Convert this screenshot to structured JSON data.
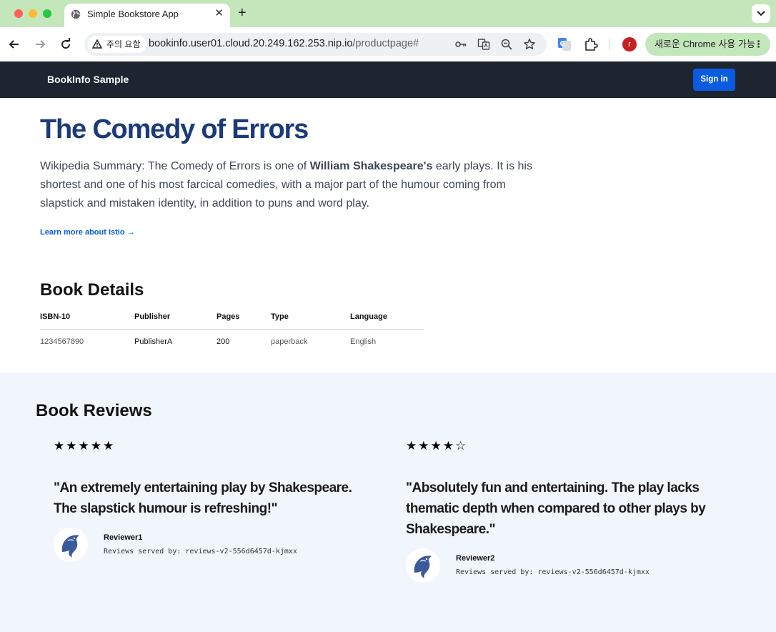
{
  "browser": {
    "tab_title": "Simple Bookstore App",
    "security_chip": "주의 요함",
    "url_host": "bookinfo.user01.cloud.20.249.162.253.nip.io",
    "url_path": "/productpage#",
    "profile_initial": "r",
    "update_label": "새로운 Chrome 사용 가능"
  },
  "navbar": {
    "brand": "BookInfo Sample",
    "signin_label": "Sign in"
  },
  "product": {
    "title": "The Comedy of Errors",
    "summary_prefix": "Wikipedia Summary: The Comedy of Errors is one of ",
    "summary_bold": "William Shakespeare's",
    "summary_suffix": " early plays. It is his shortest and one of his most farcical comedies, with a major part of the humour coming from slapstick and mistaken identity, in addition to puns and word play.",
    "learn_more": "Learn more about Istio →"
  },
  "details": {
    "heading": "Book Details",
    "columns": [
      "ISBN-10",
      "Publisher",
      "Pages",
      "Type",
      "Language"
    ],
    "values": [
      "1234567890",
      "PublisherA",
      "200",
      "paperback",
      "English"
    ]
  },
  "reviews": {
    "heading": "Book Reviews",
    "items": [
      {
        "rating": 5,
        "stars": "★★★★★",
        "text": "\"An extremely entertaining play by Shakespeare. The slapstick humour is refreshing!\"",
        "reviewer": "Reviewer1",
        "served_by": "Reviews served by: reviews-v2-556d6457d-kjmxx"
      },
      {
        "rating": 4,
        "stars": "★★★★☆",
        "text": "\"Absolutely fun and entertaining. The play lacks thematic depth when compared to other plays by Shakespeare.\"",
        "reviewer": "Reviewer2",
        "served_by": "Reviews served by: reviews-v2-556d6457d-kjmxx"
      }
    ]
  },
  "colors": {
    "navbar_bg": "#1e2530",
    "title": "#1b3a7a",
    "link": "#0a5be0",
    "reviews_bg": "#f1f6fd",
    "chrome_frame": "#c3e6bb"
  }
}
